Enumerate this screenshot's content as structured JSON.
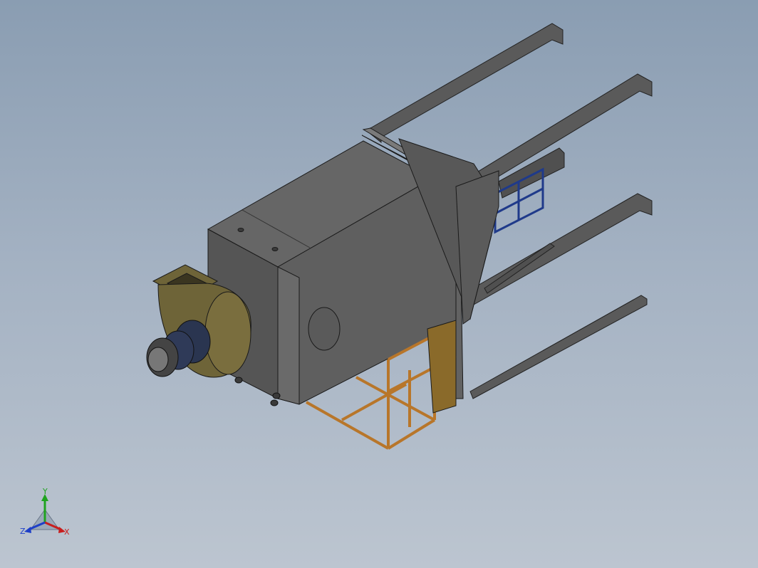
{
  "viewport": {
    "background_top": "#8a9db2",
    "background_bottom": "#bcc5d0"
  },
  "model": {
    "housing_color": "#5f5f5f",
    "housing_top_color": "#666666",
    "frame_color": "#b8762a",
    "fan_color": "#6e6438",
    "motor_color": "#2a3550",
    "beam_color": "#5a5a5a",
    "window_color": "#1f3a8a"
  },
  "triad": {
    "y_label": "Y",
    "x_label": "X",
    "z_label": "Z",
    "y_color": "#1fa31f",
    "x_color": "#c81e1e",
    "z_color": "#1e3fc8"
  }
}
